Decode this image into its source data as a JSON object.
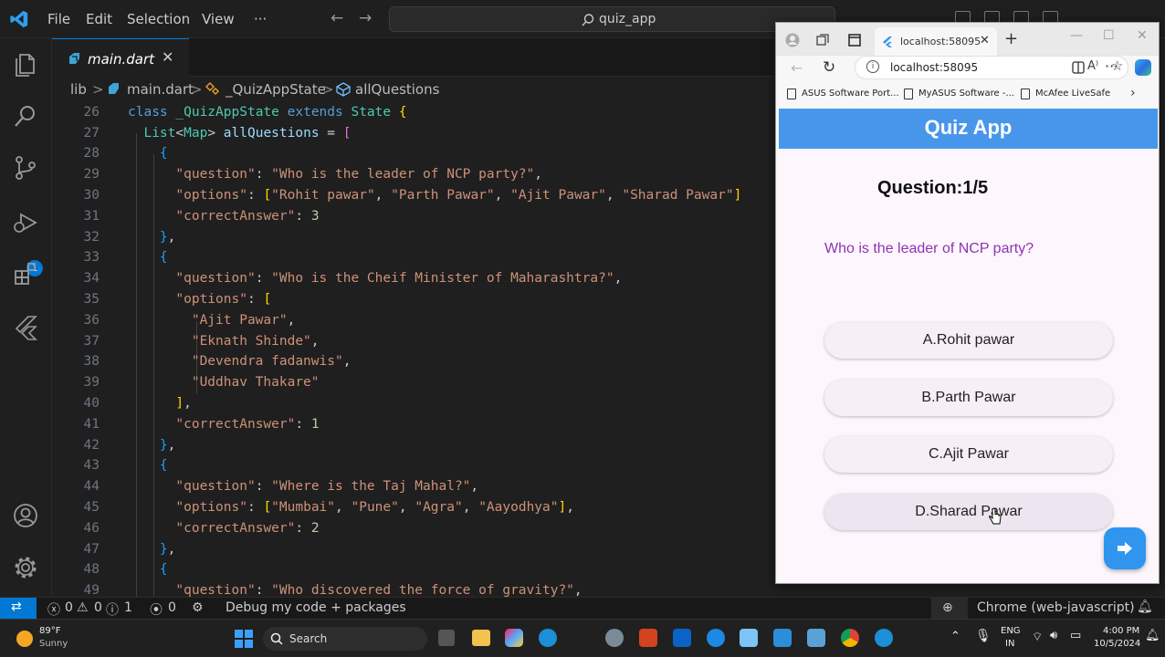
{
  "titlebar": {
    "menu": [
      "File",
      "Edit",
      "Selection",
      "View",
      "···"
    ],
    "search": "quiz_app"
  },
  "editor_tab": {
    "label": "main.dart",
    "close": "✕"
  },
  "breadcrumb": {
    "folder": "lib",
    "file": "main.dart",
    "class": "_QuizAppState",
    "member": "allQuestions",
    "sep": ">"
  },
  "badges": {
    "debug_count": "1"
  },
  "code": {
    "lines": [
      "26",
      "27",
      "28",
      "29",
      "30",
      "31",
      "32",
      "33",
      "34",
      "35",
      "36",
      "37",
      "38",
      "39",
      "40",
      "41",
      "42",
      "43",
      "44",
      "45",
      "46",
      "47",
      "48",
      "49"
    ]
  },
  "browser": {
    "tab_title": "localhost:58095",
    "address": "localhost:58095",
    "bookmarks": [
      "ASUS Software Port...",
      "MyASUS Software -...",
      "McAfee LiveSafe"
    ],
    "app_title": "Quiz App",
    "question_counter": "Question:1/5",
    "question_text": "Who is the leader of NCP party?",
    "options": [
      "A.Rohit pawar",
      "B.Parth Pawar",
      "C.Ajit Pawar",
      "D.Sharad Pawar"
    ],
    "colors": {
      "appbar": "#4896ea",
      "question": "#8e33b4",
      "fab": "#2f95ef"
    }
  },
  "statusbar": {
    "errors": "0",
    "warnings": "0",
    "info": "1",
    "ports": "0",
    "debug": "Debug my code + packages",
    "language": "Chrome (web-javascript)"
  },
  "taskbar": {
    "temp": "89°F",
    "weather": "Sunny",
    "search": "Search",
    "lang": "ENG",
    "region": "IN",
    "time": "4:00 PM",
    "date": "10/5/2024"
  }
}
